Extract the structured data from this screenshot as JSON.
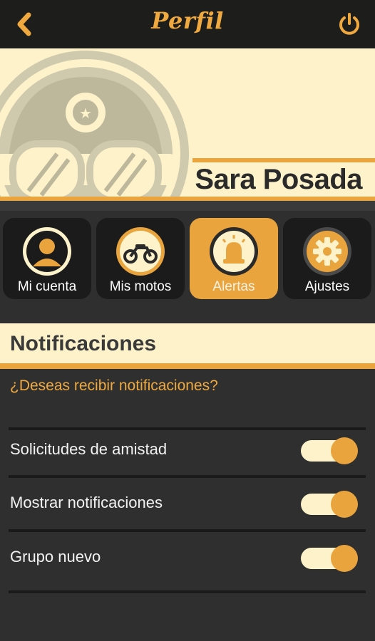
{
  "header": {
    "title": "Perfil",
    "back_icon": "chevron-left-icon",
    "power_icon": "power-icon"
  },
  "profile": {
    "name": "Sara Posada"
  },
  "tabs": [
    {
      "label": "Mi cuenta",
      "icon": "user-icon",
      "active": false
    },
    {
      "label": "Mis motos",
      "icon": "motorcycle-icon",
      "active": false
    },
    {
      "label": "Alertas",
      "icon": "siren-icon",
      "active": true
    },
    {
      "label": "Ajustes",
      "icon": "gear-icon",
      "active": false
    }
  ],
  "notifications": {
    "title": "Notificaciones",
    "question": "¿Deseas recibir notificaciones?",
    "settings": [
      {
        "label": "Solicitudes de amistad",
        "enabled": true
      },
      {
        "label": "Mostrar notificaciones",
        "enabled": true
      },
      {
        "label": "Grupo nuevo",
        "enabled": true
      }
    ]
  },
  "colors": {
    "accent": "#e9a43d",
    "cream": "#fdf2c9",
    "dark": "#2f2f2f",
    "topbar": "#1d1d1b"
  }
}
